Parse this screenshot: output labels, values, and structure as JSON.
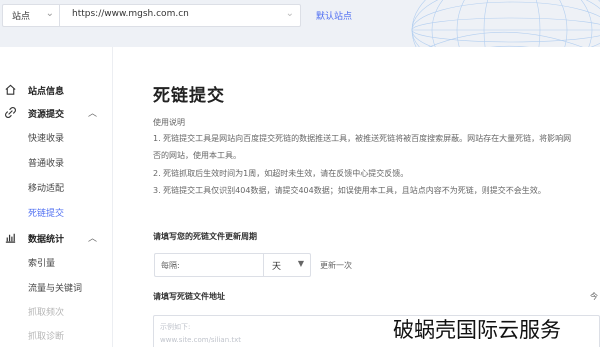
{
  "topbar": {
    "site_select_label": "站点",
    "url_value": "https://www.mgsh.com.cn",
    "default_site_link": "默认站点"
  },
  "sidebar": {
    "groups": [
      {
        "label": "站点信息",
        "icon": "home-icon"
      },
      {
        "label": "资源提交",
        "icon": "link-icon",
        "expanded": true,
        "items": [
          "快速收录",
          "普通收录",
          "移动适配",
          "死链提交"
        ]
      },
      {
        "label": "数据统计",
        "icon": "bar-chart-icon",
        "expanded": true,
        "items": [
          "索引量",
          "流量与关键词",
          "抓取频次",
          "抓取诊断"
        ]
      }
    ],
    "active_item": "死链提交"
  },
  "main": {
    "title": "死链提交",
    "description_title": "使用说明",
    "description_lines": [
      "1. 死链提交工具是网站向百度提交死链的数据推送工具，被推送死链将被百度搜索屏蔽。网站存在大量死链，将影响网",
      "否的网站，使用本工具。",
      "2. 死链抓取后生效时间为1周，如超时未生效，请在反馈中心提交反馈。",
      "3. 死链提交工具仅识别404数据，请提交404数据；如误使用本工具，且站点内容不为死链，则提交不会生效。"
    ],
    "period_section_label": "请填写您的死链文件更新周期",
    "period_placeholder": "每隔:",
    "period_unit": "天",
    "update_once": "更新一次",
    "file_section_label": "请填写死链文件地址",
    "today_label_cut": "今",
    "textarea_placeholder_1": "示例如下:",
    "textarea_placeholder_2": "www.site.com/silian.txt"
  },
  "watermark": "破蜗壳国际云服务",
  "colors": {
    "accent": "#4e6ef2",
    "topbar_bg": "#eef1f6"
  }
}
